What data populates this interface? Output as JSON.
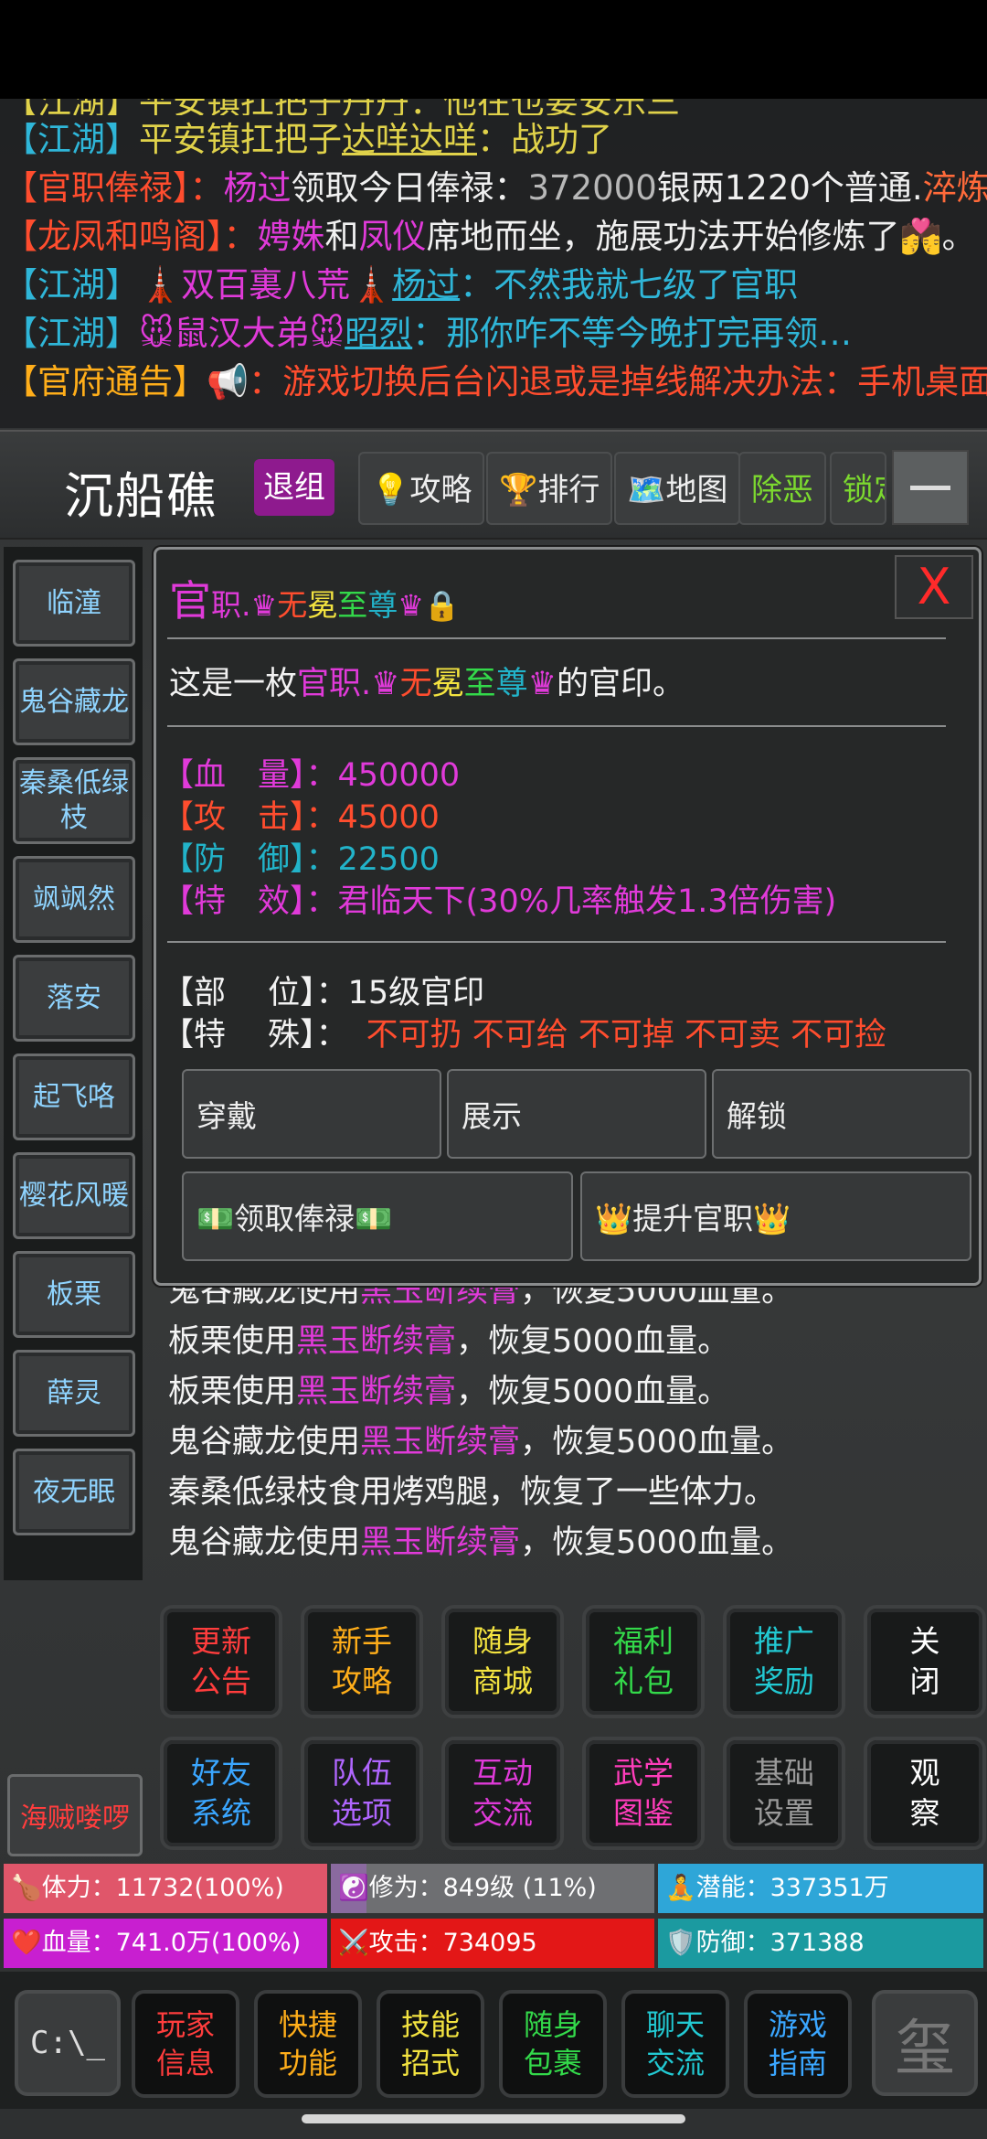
{
  "chat": {
    "partial_line": "【江湖】平安镇扛把子丹丹：他在也要安乐三",
    "lines": [
      {
        "tag": "【江湖】",
        "tag_color": "#2fb6d8",
        "sender": "平安镇扛把子",
        "sender_color": "#e0d24a",
        "name": "达咩达咩",
        "name_color": "#e0d24a",
        "msg": "：战功了",
        "msg_color": "#e0d24a"
      },
      {
        "tag": "【官职俸禄】：",
        "tag_color": "#ff4d2e",
        "name": "杨过",
        "name_color": "#e03ad9",
        "mid": "领取今日俸禄：",
        "mid_color": "#f0f0f0",
        "n": "372000",
        "n_color": "#b8b8b8",
        "rest": "银两1220个普通.",
        "rest_color": "#f0f0f0",
        "tail": "淬炼",
        "tail_color": "#ff6a3a"
      },
      {
        "tag": "【龙凤和鸣阁】：",
        "tag_color": "#ff4d2e",
        "a": "娉姝",
        "a_color": "#e03ad9",
        "b": "和",
        "b_color": "#f0f0f0",
        "c": "凤仪",
        "c_color": "#e03ad9",
        "d": "席地而坐，施展功法开始修炼了💏。",
        "d_color": "#f0f0f0"
      },
      {
        "tag": "【江湖】",
        "tag_color": "#2fb6d8",
        "pre": "🗼双百裏八荒🗼",
        "pre_color": "#e03ad9",
        "name": "杨过",
        "name_color": "#2fb6d8",
        "msg": "：不然我就七级了官职",
        "msg_color": "#2fb6d8"
      },
      {
        "tag": "【江湖】",
        "tag_color": "#2fb6d8",
        "pre": "🐭鼠汉大弟🐭",
        "pre_color": "#e03ad9",
        "name": "昭烈",
        "name_color": "#2fb6d8",
        "msg": "：那你咋不等今晚打完再领…",
        "msg_color": "#2fb6d8"
      },
      {
        "tag": "【官府通告】",
        "tag_color": "#ffae1a",
        "icon": "📢",
        "msg": "：游戏切换后台闪退或是掉线解决办法：手机桌面",
        "msg_color": "#ff4d2e"
      }
    ]
  },
  "location": {
    "title": "沉船礁",
    "buttons": [
      {
        "label": "退组",
        "color": "#ffffff"
      },
      {
        "label": "💡攻略",
        "color": "#eeeeee"
      },
      {
        "label": "🏆排行",
        "color": "#eeeeee"
      },
      {
        "label": "🗺️地图",
        "color": "#eeeeee"
      },
      {
        "label": "除恶",
        "color": "#7cd92f"
      },
      {
        "label": "锁定",
        "color": "#7cd92f"
      }
    ]
  },
  "players": [
    "临潼",
    "鬼谷藏龙",
    "秦桑低绿枝",
    "飒飒然",
    "落安",
    "起飞咯",
    "樱花风暖",
    "板栗",
    "薛灵",
    "夜无眠"
  ],
  "pirate": "海贼喽啰",
  "modal": {
    "close": "X",
    "title_a": "官",
    "title_b": "职.",
    "crown": "♛",
    "name_1": "无",
    "name_2": "冕",
    "name_3": "至",
    "name_4": "尊",
    "lock": "🔒",
    "desc_pre": "这是一枚",
    "desc_post": "的官印。",
    "stats": [
      {
        "label": "【血　量】：",
        "value": "450000",
        "color": "#e03ad9"
      },
      {
        "label": "【攻　击】：",
        "value": "45000",
        "color": "#ff4d2e"
      },
      {
        "label": "【防　御】：",
        "value": "22500",
        "color": "#22b3c9"
      },
      {
        "label": "【特　效】：",
        "value": "君临天下(30%几率触发1.3倍伤害)",
        "color": "#e03ad9"
      }
    ],
    "part_label": "【部　 位】：",
    "part_value": "15级官印",
    "special_label": "【特　 殊】：",
    "special_value": "不可扔 不可给 不可掉 不可卖 不可捡",
    "actions": [
      "穿戴",
      "展示",
      "解锁"
    ],
    "salary": "💵领取俸禄💵",
    "promote": "👑提升官职👑"
  },
  "log": [
    {
      "p1": "鬼谷藏龙使用",
      "item": "黑玉断续膏",
      "p2": "，恢复5000血量。"
    },
    {
      "p1": "板栗使用",
      "item": "黑玉断续膏",
      "p2": "，恢复5000血量。"
    },
    {
      "p1": "板栗使用",
      "item": "黑玉断续膏",
      "p2": "，恢复5000血量。"
    },
    {
      "p1": "鬼谷藏龙使用",
      "item": "黑玉断续膏",
      "p2": "，恢复5000血量。"
    },
    {
      "p1": "秦桑低绿枝食用烤鸡腿，恢复了一些体力。",
      "item": "",
      "p2": ""
    },
    {
      "p1": "鬼谷藏龙使用",
      "item": "黑玉断续膏",
      "p2": "，恢复5000血量。"
    }
  ],
  "quick_menu": [
    {
      "l1": "更新",
      "l2": "公告",
      "color": "#ff3d3d"
    },
    {
      "l1": "新手",
      "l2": "攻略",
      "color": "#ffae1a"
    },
    {
      "l1": "随身",
      "l2": "商城",
      "color": "#f3e340"
    },
    {
      "l1": "福利",
      "l2": "礼包",
      "color": "#33d94a"
    },
    {
      "l1": "推广",
      "l2": "奖励",
      "color": "#22c9d2"
    },
    {
      "l1": "关",
      "l2": "闭",
      "color": "#ffffff"
    },
    {
      "l1": "好友",
      "l2": "系统",
      "color": "#3aa6ff"
    },
    {
      "l1": "队伍",
      "l2": "选项",
      "color": "#b066ff"
    },
    {
      "l1": "互动",
      "l2": "交流",
      "color": "#e03ad9"
    },
    {
      "l1": "武学",
      "l2": "图鉴",
      "color": "#ff3dbb"
    },
    {
      "l1": "基础",
      "l2": "设置",
      "color": "#9a9a9a"
    },
    {
      "l1": "观",
      "l2": "察",
      "color": "#ffffff"
    }
  ],
  "stats_bars": [
    {
      "text": "🍗体力：11732(100%)",
      "bg": "#e0566a"
    },
    {
      "text": "☯️修为：849级 (11%)",
      "bg": "#6e6f72",
      "fill_pct": 11,
      "fill": "#8a6a9f"
    },
    {
      "text": "🧘潜能：337351万",
      "bg": "#2ea6d8"
    },
    {
      "text": "❤️血量：741.0万(100%)",
      "bg": "#c81fd0"
    },
    {
      "text": "⚔️攻击：734095",
      "bg": "#e31717"
    },
    {
      "text": "🛡️防御：371388",
      "bg": "#1b9aa0"
    }
  ],
  "bottom_nav": [
    {
      "l1": "玩家",
      "l2": "信息",
      "color": "#ff3d3d"
    },
    {
      "l1": "快捷",
      "l2": "功能",
      "color": "#ffae1a"
    },
    {
      "l1": "技能",
      "l2": "招式",
      "color": "#f3e340"
    },
    {
      "l1": "随身",
      "l2": "包裹",
      "color": "#33d94a"
    },
    {
      "l1": "聊天",
      "l2": "交流",
      "color": "#22c9d2"
    },
    {
      "l1": "游戏",
      "l2": "指南",
      "color": "#3aa6ff"
    }
  ],
  "cl_label": "C:\\_",
  "seal_char": "玺"
}
